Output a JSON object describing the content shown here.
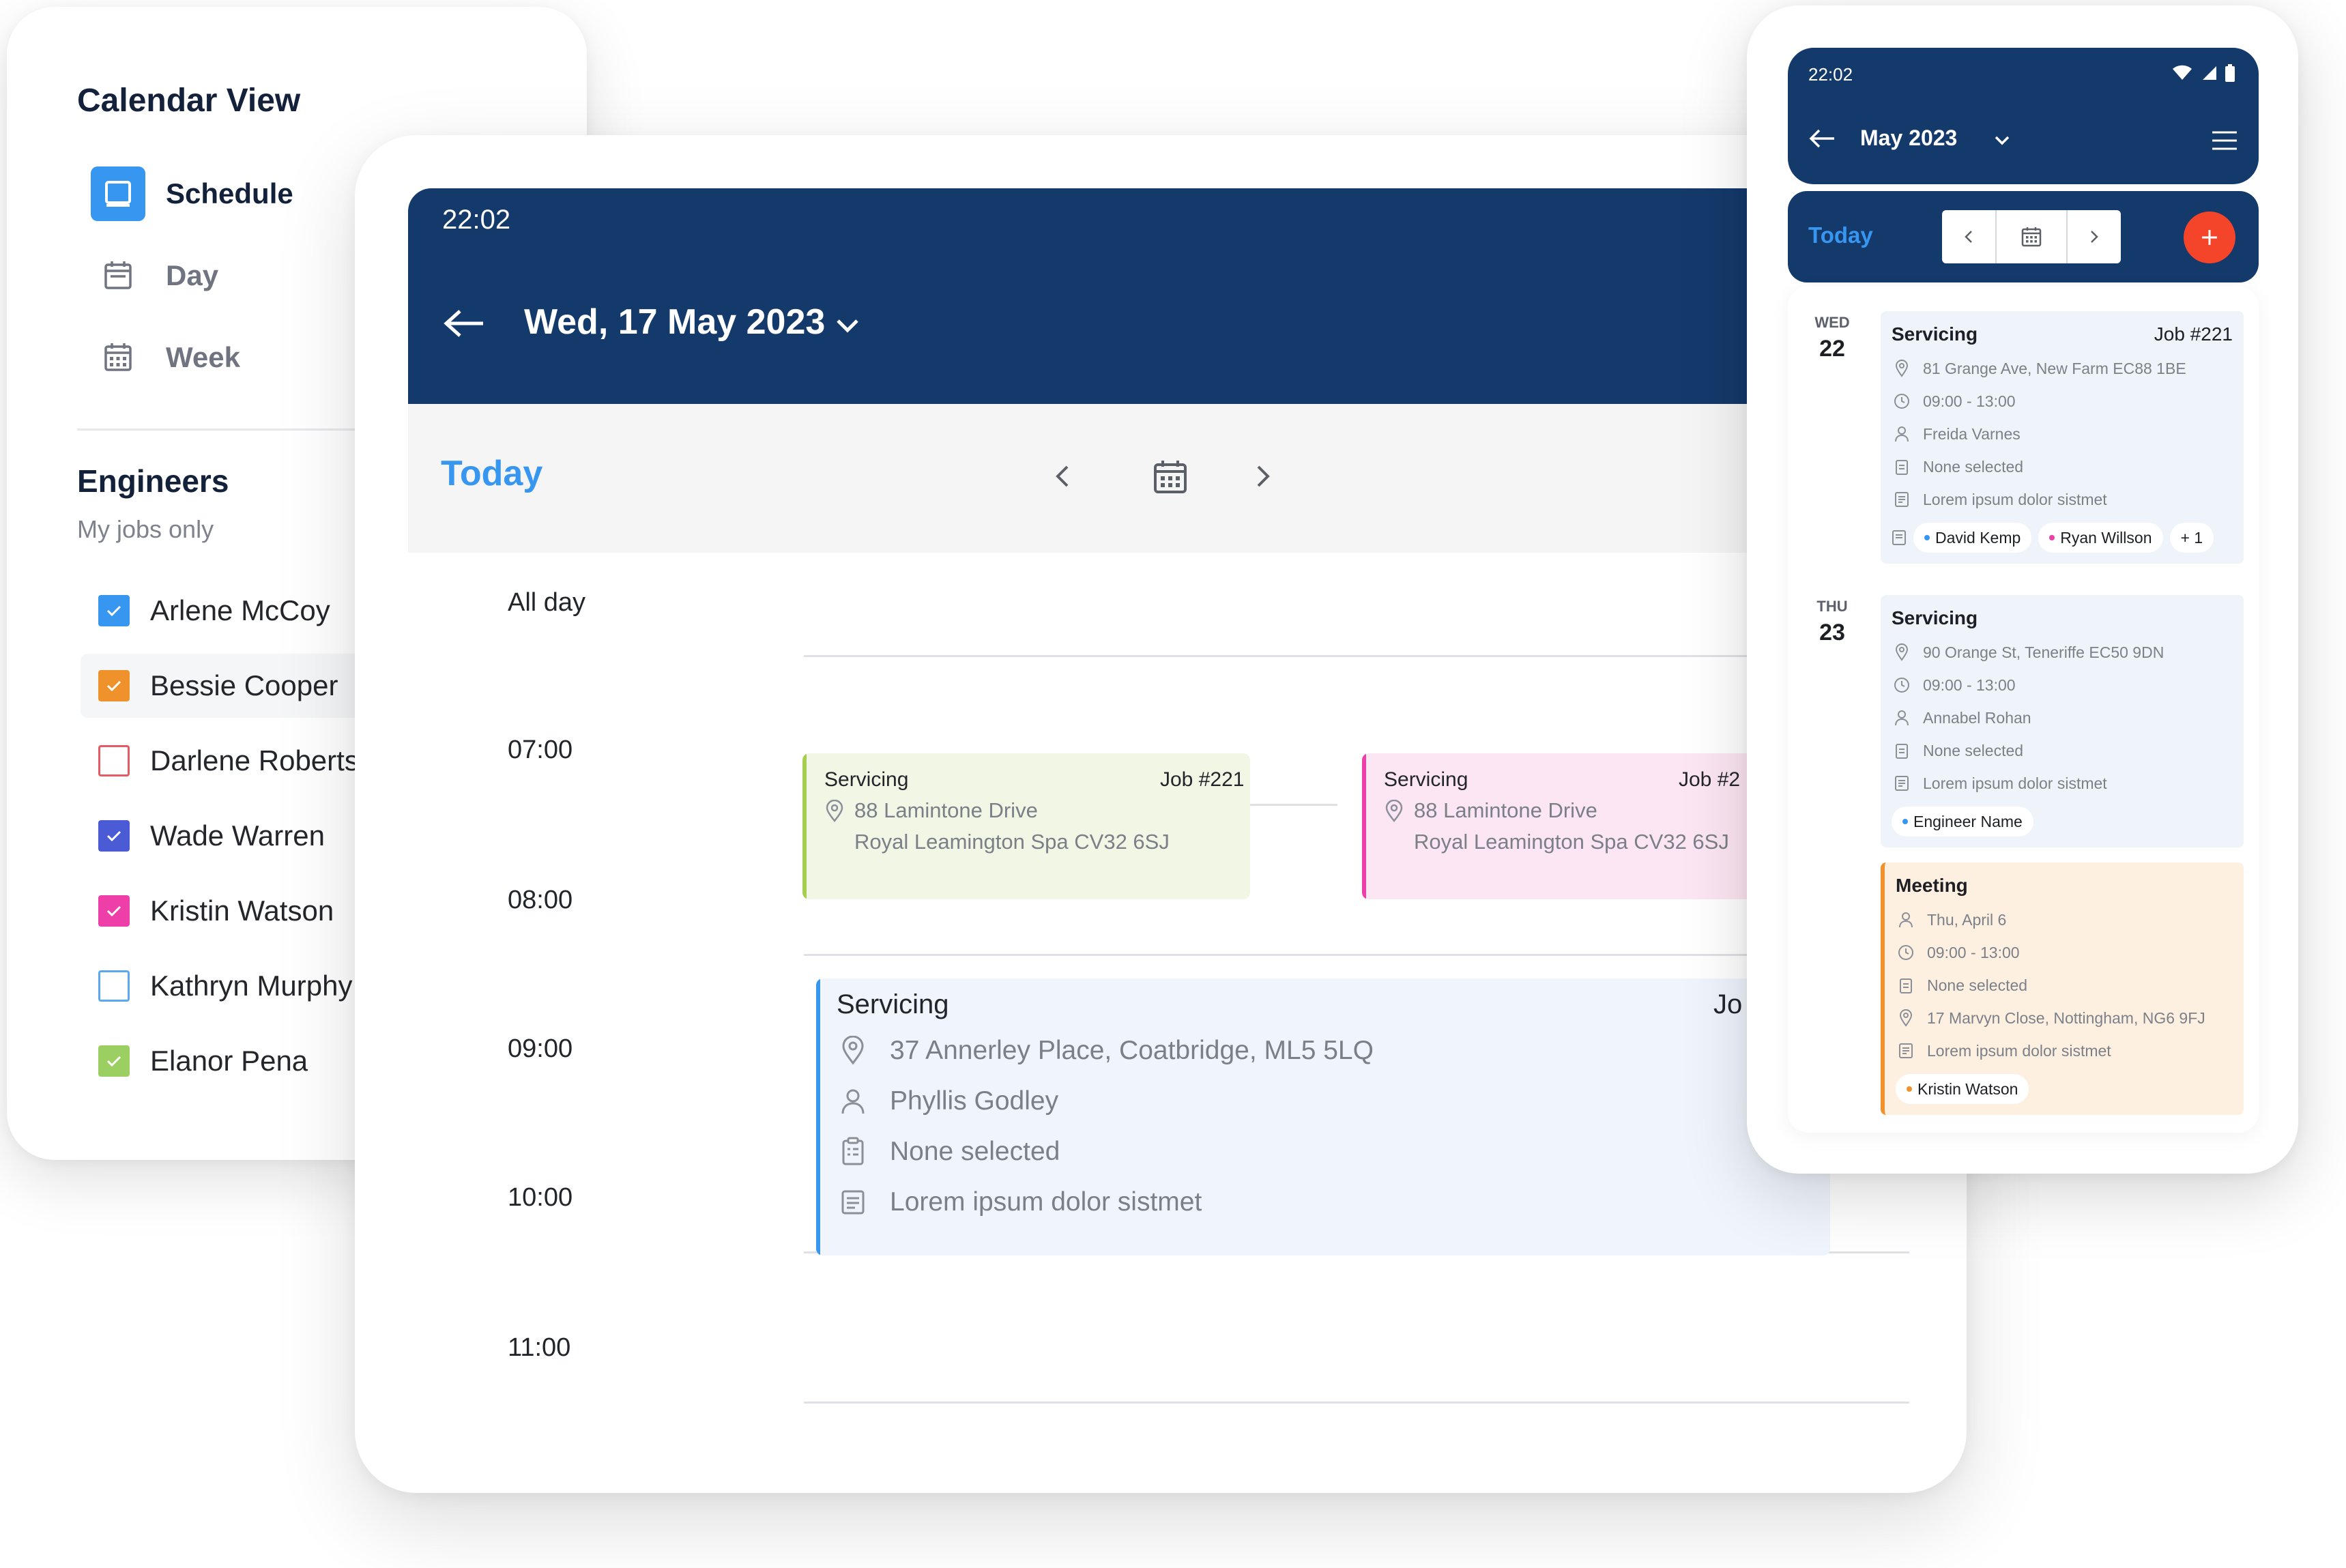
{
  "side_panel": {
    "title": "Calendar View",
    "views": [
      {
        "label": "Schedule",
        "icon": "schedule-icon",
        "active": true
      },
      {
        "label": "Day",
        "icon": "calendar-day-icon",
        "active": false
      },
      {
        "label": "Week",
        "icon": "calendar-week-icon",
        "active": false
      }
    ],
    "engineers_title": "Engineers",
    "engineers_subtitle": "My jobs only",
    "engineers": [
      {
        "name": "Arlene McCoy",
        "checked": true,
        "color": "#3797f0"
      },
      {
        "name": "Bessie Cooper",
        "checked": true,
        "color": "#f0922b"
      },
      {
        "name": "Darlene Roberts",
        "checked": false,
        "color": "#e35b64"
      },
      {
        "name": "Wade Warren",
        "checked": true,
        "color": "#4b5bd6"
      },
      {
        "name": "Kristin Watson",
        "checked": true,
        "color": "#ee3fa8"
      },
      {
        "name": "Kathryn Murphy",
        "checked": false,
        "color": "#5aa9f0"
      },
      {
        "name": "Elanor Pena",
        "checked": true,
        "color": "#9ccf62"
      }
    ]
  },
  "tablet": {
    "time": "22:02",
    "date": "Wed, 17 May 2023",
    "today_label": "Today",
    "slots": [
      "All day",
      "07:00",
      "08:00",
      "09:00",
      "10:00",
      "11:00"
    ],
    "events": [
      {
        "title": "Servicing",
        "job": "Job #221",
        "address_line1": "88 Lamintone Drive",
        "address_line2": "Royal Leamington Spa CV32 6SJ",
        "color": "#a6cf4d",
        "bg": "#f2f6e5"
      },
      {
        "title": "Servicing",
        "job": "Job #2",
        "address_line1": "88 Lamintone Drive",
        "address_line2": "Royal Leamington Spa CV32 6SJ",
        "color": "#ee3fa8",
        "bg": "#fde6f3"
      }
    ],
    "big_event": {
      "title": "Servicing",
      "job": "Jo",
      "address": "37 Annerley Place, Coatbridge, ML5 5LQ",
      "person": "Phyllis Godley",
      "selection": "None selected",
      "note": "Lorem ipsum dolor sistmet",
      "color": "#3797f0",
      "bg": "#f0f5fd"
    }
  },
  "phone": {
    "time": "22:02",
    "month": "May 2023",
    "today_label": "Today",
    "days": [
      {
        "dow": "WED",
        "dom": "22",
        "card": {
          "title": "Servicing",
          "job": "Job #221",
          "address": "81 Grange Ave, New Farm EC88 1BE",
          "time": "09:00 - 13:00",
          "person": "Freida Varnes",
          "selection": "None selected",
          "note": "Lorem ipsum dolor sistmet",
          "chips": [
            "David Kemp",
            "Ryan Willson",
            "+ 1"
          ]
        }
      },
      {
        "dow": "THU",
        "dom": "23",
        "card": {
          "title": "Servicing",
          "address": "90 Orange St, Teneriffe EC50 9DN",
          "time": "09:00 - 13:00",
          "person": "Annabel Rohan",
          "selection": "None selected",
          "note": "Lorem ipsum dolor sistmet",
          "chips": [
            "Engineer Name"
          ]
        },
        "meeting": {
          "title": "Meeting",
          "date": "Thu, April 6",
          "time": "09:00 - 13:00",
          "selection": "None selected",
          "address": "17 Marvyn Close, Nottingham, NG6 9FJ",
          "note": "Lorem ipsum dolor sistmet",
          "chips": [
            "Kristin Watson"
          ]
        }
      }
    ],
    "colors": {
      "header": "#14396b",
      "accent": "#3797f0",
      "add": "#f4452b",
      "card": "#eff3fa",
      "meeting": "#fdf0e1",
      "meeting_bar": "#f0922b"
    }
  }
}
